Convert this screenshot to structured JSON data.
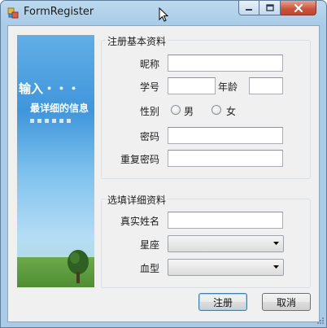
{
  "window": {
    "title": "FormRegister",
    "icon": "form-app-icon",
    "controls": {
      "minimize": "minimize-icon",
      "maximize": "maximize-icon",
      "close": "close-icon"
    }
  },
  "banner": {
    "line1": "输入・・・",
    "line2": "最详细的信息"
  },
  "basic": {
    "group_title": "注册基本资料",
    "nickname_label": "昵称",
    "nickname_value": "",
    "student_id_label": "学号",
    "student_id_value": "",
    "age_label": "年龄",
    "age_value": "",
    "gender_label": "性别",
    "gender_male": "男",
    "gender_female": "女",
    "gender_selected": "",
    "password_label": "密码",
    "password_value": "",
    "confirm_label": "重复密码",
    "confirm_value": ""
  },
  "details": {
    "group_title": "选填详细资料",
    "realname_label": "真实姓名",
    "realname_value": "",
    "zodiac_label": "星座",
    "zodiac_value": "",
    "blood_label": "血型",
    "blood_value": ""
  },
  "actions": {
    "register_label": "注册",
    "cancel_label": "取消"
  },
  "colors": {
    "titlebar": "#a9cbe6",
    "client_bg": "#f0f0f0",
    "close_button": "#c4462d",
    "banner_sky": "#3f96db",
    "banner_grass": "#4e8e33"
  }
}
